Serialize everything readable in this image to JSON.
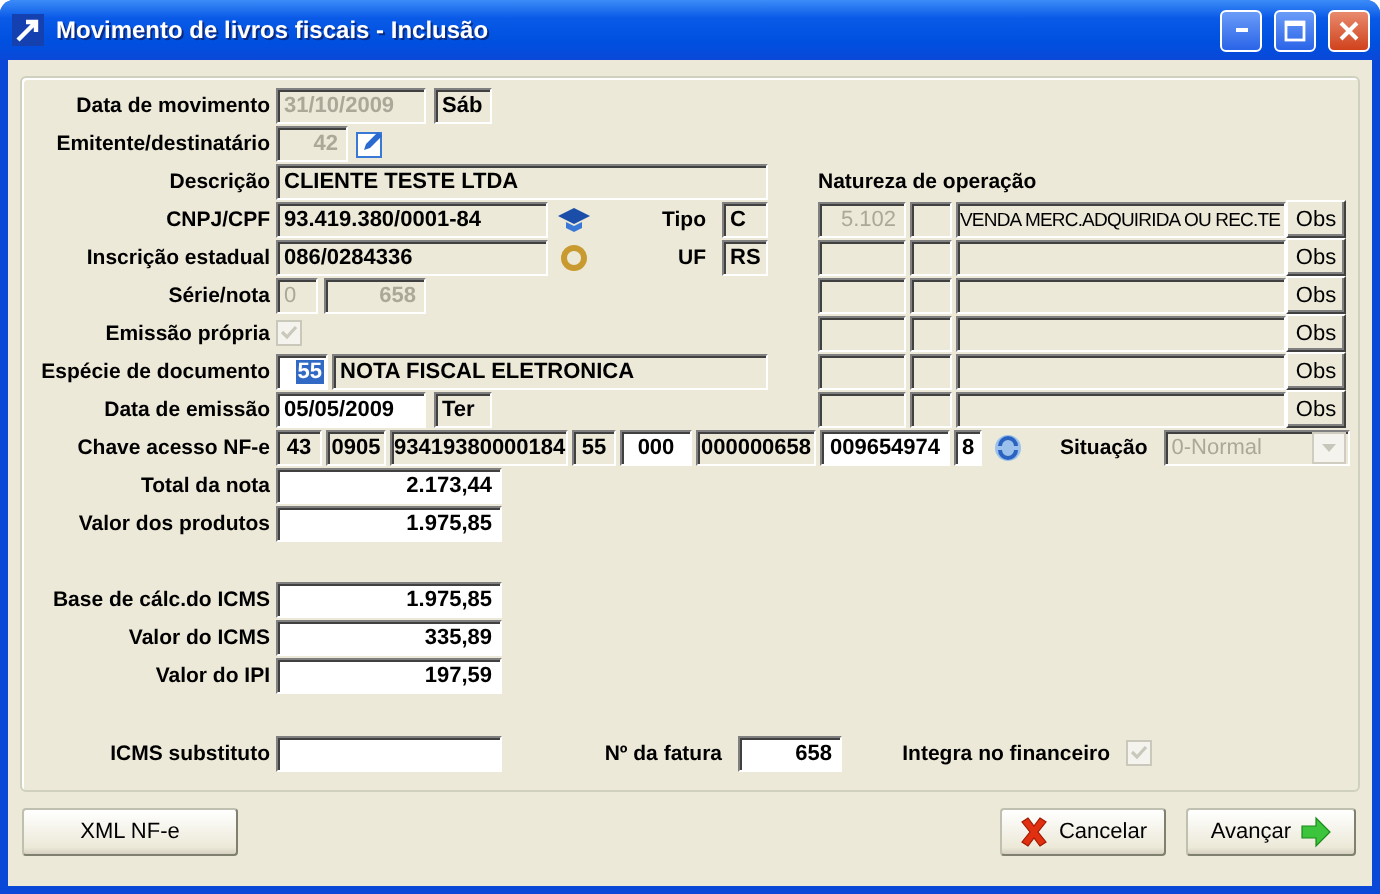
{
  "window": {
    "title": "Movimento de livros fiscais - Inclusão"
  },
  "data_movimento": {
    "label": "Data de movimento",
    "value": "31/10/2009",
    "disabled": true,
    "weekday": "Sáb"
  },
  "emitente": {
    "label": "Emitente/destinatário",
    "value": "42",
    "disabled": true
  },
  "descricao": {
    "label": "Descrição",
    "value": "CLIENTE TESTE LTDA",
    "editable": false
  },
  "cnpj": {
    "label": "CNPJ/CPF",
    "value": "93.419.380/0001-84",
    "editable": false
  },
  "tipo": {
    "label": "Tipo",
    "value": "C",
    "editable": false
  },
  "inscricao": {
    "label": "Inscrição estadual",
    "value": "086/0284336",
    "editable": false
  },
  "uf": {
    "label": "UF",
    "value": "RS",
    "editable": false
  },
  "serie_nota": {
    "label": "Série/nota",
    "serie": "0",
    "nota": "658",
    "disabled": true
  },
  "emissao_propria": {
    "label": "Emissão própria",
    "checked": true,
    "disabled": true
  },
  "especie": {
    "label": "Espécie de documento",
    "code": "55",
    "code_selected": true,
    "description": "NOTA FISCAL ELETRONICA",
    "editable": false
  },
  "data_emissao": {
    "label": "Data de emissão",
    "value": "05/05/2009",
    "editable": true,
    "weekday": "Ter"
  },
  "chave": {
    "label": "Chave acesso NF-e",
    "parts": [
      {
        "value": "43",
        "editable": false
      },
      {
        "value": "0905",
        "editable": false
      },
      {
        "value": "93419380000184",
        "editable": false
      },
      {
        "value": "55",
        "editable": false
      },
      {
        "value": "000",
        "editable": true
      },
      {
        "value": "000000658",
        "editable": false
      },
      {
        "value": "009654974",
        "editable": true
      },
      {
        "value": "8",
        "editable": true
      }
    ]
  },
  "situacao": {
    "label": "Situação",
    "value": "0-Normal",
    "disabled": true
  },
  "natureza": {
    "heading": "Natureza de operação",
    "rows": [
      {
        "cfop": "5.102",
        "description": "VENDA MERC.ADQUIRIDA OU REC.TE",
        "button": "Obs"
      },
      {
        "button": "Obs"
      },
      {
        "button": "Obs"
      },
      {
        "button": "Obs"
      },
      {
        "button": "Obs"
      },
      {
        "button": "Obs"
      }
    ]
  },
  "value_groups": [
    {
      "fields": [
        {
          "label": "Total da nota",
          "value": "2.173,44"
        },
        {
          "label": "Valor dos produtos",
          "value": "1.975,85"
        }
      ]
    },
    {
      "fields": [
        {
          "label": "Base de cálc.do ICMS",
          "value": "1.975,85"
        },
        {
          "label": "Valor do ICMS",
          "value": "335,89"
        },
        {
          "label": "Valor do IPI",
          "value": "197,59"
        }
      ]
    }
  ],
  "icms_substituto": {
    "label": "ICMS substituto"
  },
  "fatura": {
    "label": "Nº da fatura",
    "value": "658"
  },
  "integra": {
    "label": "Integra no financeiro",
    "checked": true,
    "disabled": true
  },
  "buttons": [
    {
      "label": "XML NF-e",
      "kind": "plain"
    },
    {
      "label": "Cancelar",
      "kind": "cancel"
    },
    {
      "label": "Avançar",
      "kind": "next"
    }
  ]
}
